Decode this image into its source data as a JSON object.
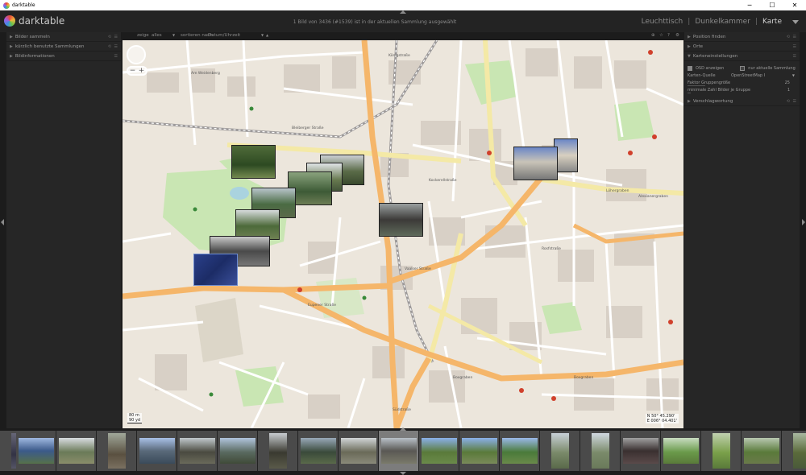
{
  "window": {
    "title": "darktable",
    "minimize": "─",
    "maximize": "☐",
    "close": "✕"
  },
  "header": {
    "logo_text": "darktable",
    "collection_info": "1 Bild von 3436 (#1539) ist in der aktuellen Sammlung ausgewählt",
    "views": [
      "Leuchttisch",
      "Dunkelkammer",
      "Karte"
    ],
    "separator": "|",
    "active_view": "Karte"
  },
  "left_panel": {
    "modules": [
      "Bilder sammeln",
      "kürzlich benutzte Sammlungen",
      "Bildinformationen"
    ]
  },
  "toolbar": {
    "show_label": "zeige",
    "show_value": "alles",
    "sort_label": "sortieren nach",
    "sort_value": "Datum/Uhrzeit",
    "sort_dir": "▲"
  },
  "right_panel": {
    "modules": [
      "Position finden",
      "Orte",
      "Karteneinstellungen"
    ],
    "osd_label": "OSD anzeigen",
    "current_collection_label": "nur aktuelle Sammlung",
    "map_source_label": "Karten-Quelle",
    "map_source_value": "OpenStreetMap I",
    "group_factor_label": "Faktor Gruppengröße",
    "group_factor_value": "25",
    "min_images_label": "minimale Zahl Bilder je Gruppe",
    "min_images_value": "1",
    "preview_module": "Verschlagwortung"
  },
  "map": {
    "scale_m": "80 m",
    "scale_yd": "90 yd",
    "coord_n": "N 50° 45.290'",
    "coord_e": "E 006° 04.401'",
    "streets": [
      "Am Weidenberg",
      "Malteserstraße",
      "Heinrichsallee",
      "Bleiberger Straße",
      "Königstraße",
      "Lothringer Straße",
      "Löhergraben",
      "Alexianergraben",
      "Vaalser Straße",
      "Kockerellstraße",
      "Boxgraben",
      "Eupener Straße",
      "Südstraße",
      "Rosfstraße",
      "Jakobstraße",
      "Dennewartstraße",
      "Wilhelmstraße",
      "Annuntiatenbach",
      "Karlsgraben",
      "Weyhestraße",
      "Ludwigsallee",
      "Junkerstraße",
      "Templergraben",
      "Mauerstraße"
    ],
    "pois": [
      "Kirche St. Paul",
      "Kloster der Karmelitinnen",
      "Kita St. Jakob",
      "Kindergartenhaus",
      "Unterhauskapelle (DLK)",
      "Marienhospital",
      "Kirche St. Jakob",
      "Gymnasium",
      "Volksbibliothek",
      "Elisabethkapelle",
      "Vaalser Straße",
      "Westpark",
      "Kinderspielplatz Westpark",
      "Pluma Kaffeerösterei",
      "Die Kachel Gebaute Bücherei",
      "Krankenhaus am Luisenhospital"
    ],
    "colors": {
      "road_primary": "#f5b66a",
      "road_secondary": "#f4e9a6",
      "rail": "#9d9a9a",
      "park": "#c9e6b3",
      "water": "#aad3df",
      "building": "#d8d0c6"
    }
  },
  "filmstrip": {
    "count": 20,
    "selected_index": 9
  }
}
